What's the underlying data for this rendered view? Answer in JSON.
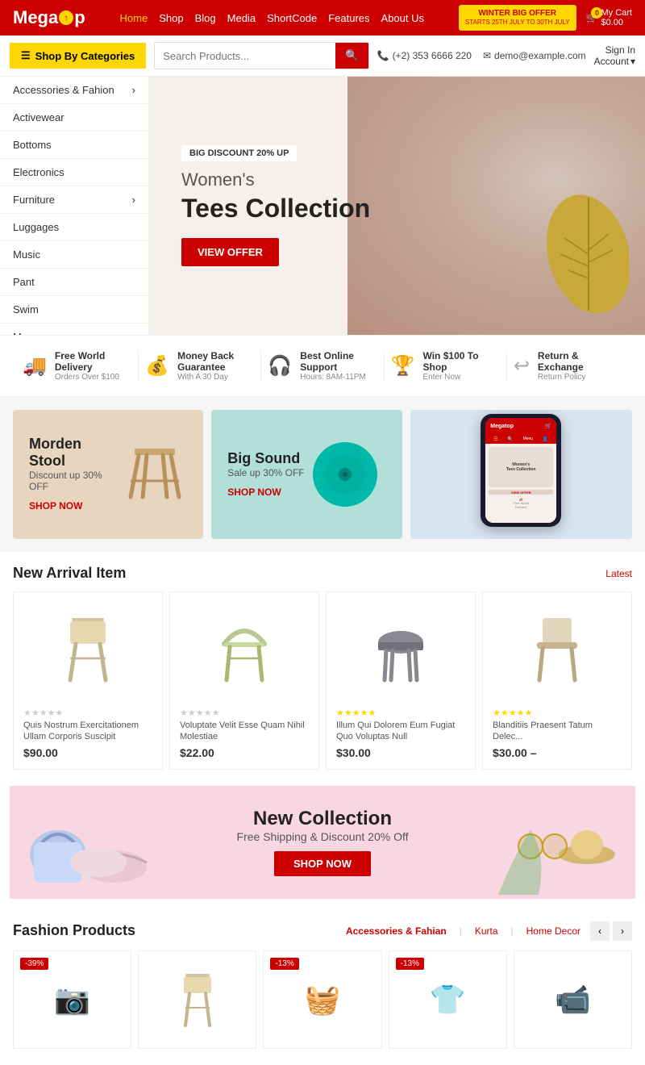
{
  "brand": {
    "name_part1": "Mega",
    "name_part2": "p",
    "name_part3": ""
  },
  "topbar": {
    "nav_items": [
      "Home",
      "Shop",
      "Blog",
      "Media",
      "ShortCode",
      "Features",
      "About Us"
    ],
    "nav_active": "Home",
    "winter_offer_line1": "WINTER BIG OFFER",
    "winter_offer_line2": "STARTS 25TH JULY TO 30TH JULY",
    "cart_label": "My Cart",
    "cart_amount": "$0.00",
    "cart_count": "0"
  },
  "searchbar": {
    "category_label": "Shop By Categories",
    "search_placeholder": "Search Products...",
    "phone": "(+2) 353 6666 220",
    "email": "demo@example.com",
    "signin_label": "Sign In",
    "account_label": "Account"
  },
  "sidebar": {
    "items": [
      {
        "label": "Accessories & Fahion",
        "has_arrow": true
      },
      {
        "label": "Activewear",
        "has_arrow": false
      },
      {
        "label": "Bottoms",
        "has_arrow": false
      },
      {
        "label": "Electronics",
        "has_arrow": false
      },
      {
        "label": "Furniture",
        "has_arrow": true
      },
      {
        "label": "Luggages",
        "has_arrow": false
      },
      {
        "label": "Music",
        "has_arrow": false
      },
      {
        "label": "Pant",
        "has_arrow": false
      },
      {
        "label": "Swim",
        "has_arrow": false
      },
      {
        "label": "More",
        "has_arrow": false
      }
    ]
  },
  "hero": {
    "badge": "BIG DISCOUNT 20% UP",
    "subtitle": "Women's",
    "title": "Tees Collection",
    "cta": "VIEW OFFER"
  },
  "features": [
    {
      "icon": "🚚",
      "title": "Free World Delivery",
      "sub": "Orders Over $100"
    },
    {
      "icon": "💰",
      "title": "Money Back Guarantee",
      "sub": "With A 30 Day"
    },
    {
      "icon": "🎧",
      "title": "Best Online Support",
      "sub": "Hours: 8AM-11PM"
    },
    {
      "icon": "🏆",
      "title": "Win $100 To Shop",
      "sub": "Enter Now"
    },
    {
      "icon": "↩",
      "title": "Return & Exchange",
      "sub": "Return Policy"
    }
  ],
  "promos": [
    {
      "title": "Morden Stool",
      "sub": "Discount up 30% OFF",
      "link": "SHOP NOW"
    },
    {
      "title": "Big Sound",
      "sub": "Sale up 30% OFF",
      "link": "SHOP NOW"
    },
    {
      "type": "phone"
    }
  ],
  "new_arrival": {
    "title": "New Arrival Item",
    "link": "Latest",
    "products": [
      {
        "name": "Quis Nostrum Exercitationem Ullam Corporis Suscipit",
        "price": "$90.00",
        "stars": 0
      },
      {
        "name": "Voluptate Velit Esse Quam Nihil Molestiae",
        "price": "$22.00",
        "stars": 0
      },
      {
        "name": "Illum Qui Dolorem Eum Fugiat Quo Voluptas Null",
        "price": "$30.00",
        "stars": 5
      },
      {
        "name": "Blanditiis Praesent Tatum Delec...",
        "price": "$30.00 –",
        "stars": 5
      }
    ]
  },
  "new_collection": {
    "title": "New Collection",
    "subtitle": "Free Shipping & Discount 20% Off",
    "cta": "SHOP NOW"
  },
  "fashion_products": {
    "title": "Fashion Products",
    "tabs": [
      "Accessories & Fahian",
      "Kurta",
      "Home Decor"
    ],
    "products": [
      {
        "name": "Camera",
        "discount": "-39%",
        "icon": "📷"
      },
      {
        "name": "Chair",
        "discount": null,
        "icon": "🪑"
      },
      {
        "name": "Basket",
        "discount": "-13%",
        "icon": "🧺"
      },
      {
        "name": "Shirt",
        "discount": "-13%",
        "icon": "👕"
      },
      {
        "name": "Camera 2",
        "discount": null,
        "icon": "📹"
      }
    ]
  }
}
